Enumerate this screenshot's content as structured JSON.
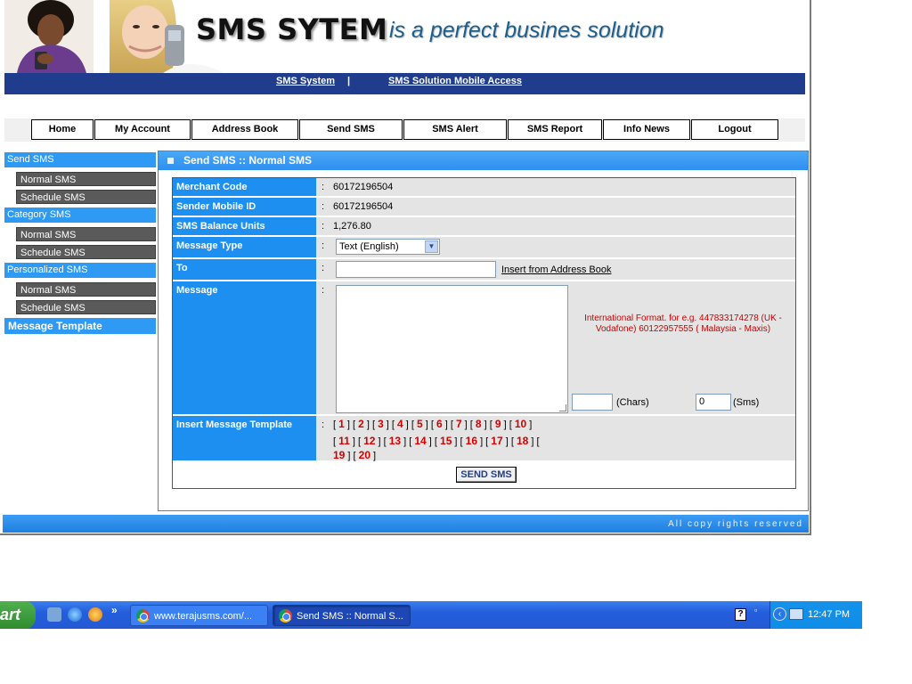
{
  "header": {
    "brand": "SMS SYTEM",
    "tagline": "is a perfect busines solution",
    "links": [
      "SMS System",
      "SMS Solution Mobile Access"
    ],
    "separator": "|"
  },
  "menu": [
    "Home",
    "My Account",
    "Address Book",
    "Send SMS",
    "SMS Alert",
    "SMS Report",
    "Info News",
    "Logout"
  ],
  "sidebar": {
    "send_sms": "Send SMS",
    "send_items": [
      "Normal SMS",
      "Schedule SMS"
    ],
    "category_sms": "Category SMS",
    "category_items": [
      "Normal SMS",
      "Schedule SMS"
    ],
    "personalized_sms": "Personalized SMS",
    "personalized_items": [
      "Normal SMS",
      "Schedule SMS"
    ],
    "message_template": "Message Template"
  },
  "panel": {
    "title": "Send SMS :: Normal SMS"
  },
  "form": {
    "colon": ":",
    "merchant_code_label": "Merchant Code",
    "merchant_code": "60172196504",
    "sender_label": "Sender Mobile ID",
    "sender": "60172196504",
    "balance_label": "SMS Balance Units",
    "balance": "1,276.80",
    "type_label": "Message Type",
    "type_value": "Text (English)",
    "to_label": "To",
    "to_value": "",
    "insert_address": "Insert from Address Book",
    "message_label": "Message",
    "intl_note": "International Format. for e.g. 447833174278 (UK - Vodafone) 60122957555 ( Malaysia - Maxis)",
    "chars_value": "",
    "chars_label": "(Chars)",
    "sms_value": "0",
    "sms_label": "(Sms)",
    "template_label": "Insert Message Template",
    "templates": [
      "1",
      "2",
      "3",
      "4",
      "5",
      "6",
      "7",
      "8",
      "9",
      "10",
      "11",
      "12",
      "13",
      "14",
      "15",
      "16",
      "17",
      "18",
      "19",
      "20"
    ],
    "send_button": "SEND SMS"
  },
  "footer": {
    "text": "All copy rights reserved"
  },
  "taskbar": {
    "start": "art",
    "tasks": [
      "www.terajusms.com/...",
      "Send SMS :: Normal S..."
    ],
    "clock": "12:47 PM",
    "chevron": "»"
  }
}
